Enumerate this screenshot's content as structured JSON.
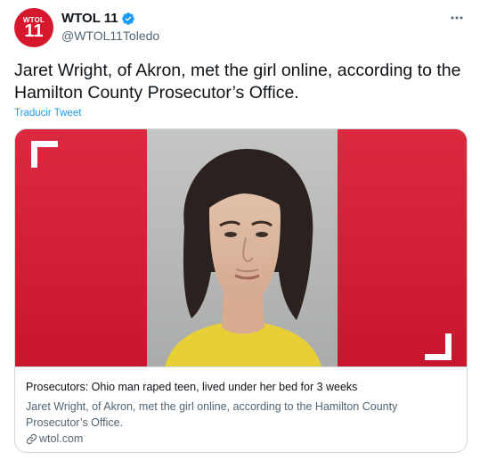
{
  "account": {
    "avatar_small": "WTOL",
    "avatar_big": "11",
    "display_name": "WTOL 11",
    "handle": "@WTOL11Toledo"
  },
  "tweet": {
    "text": "Jaret Wright, of Akron, met the girl online, according to the Hamilton County Prosecutor’s Office.",
    "translate_label": "Traducir Tweet"
  },
  "card": {
    "title": "Prosecutors: Ohio man raped teen, lived under her bed for 3 weeks",
    "description": "Jaret Wright, of Akron, met the girl online, according to the Hamilton County Prosecutor’s Office.",
    "domain": "wtol.com"
  },
  "colors": {
    "brand_red": "#d6182c",
    "link_blue": "#1d9bf0",
    "verified_blue": "#1d9bf0"
  },
  "icons": {
    "verified": "verified-badge-icon",
    "more": "more-horizontal-icon",
    "link": "link-icon",
    "corner_tl": "corner-bracket-icon",
    "corner_br": "corner-bracket-icon"
  }
}
